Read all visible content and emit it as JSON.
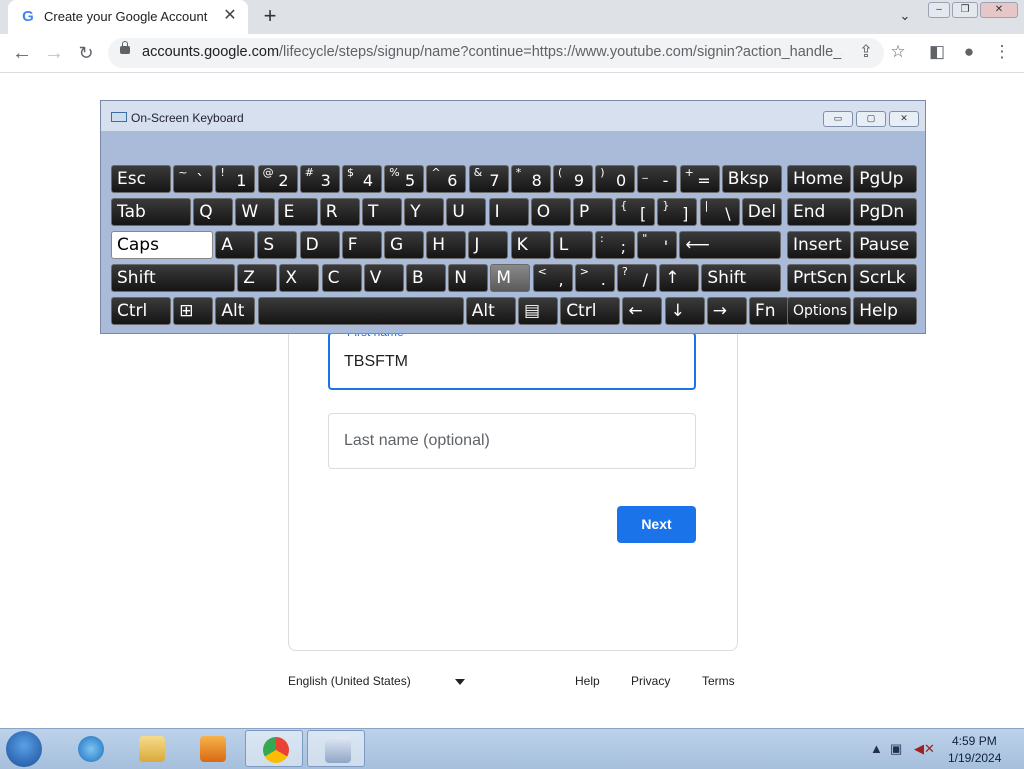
{
  "browser": {
    "tab_title": "Create your Google Account",
    "tab_favicon": "G",
    "url_host": "accounts.google.com",
    "url_rest": "/lifecycle/steps/signup/name?continue=https://www.youtube.com/signin?action_handle_si...",
    "colors": {
      "accent": "#1a73e8",
      "tabbar": "#dee1e6"
    }
  },
  "form": {
    "first_name_label": "First name",
    "first_name_value": "TBSFTM",
    "last_name_placeholder": "Last name (optional)",
    "next_label": "Next"
  },
  "footer": {
    "language": "English (United States)",
    "help": "Help",
    "privacy": "Privacy",
    "terms": "Terms"
  },
  "osk": {
    "title": "On-Screen Keyboard",
    "rows": [
      [
        {
          "l": "Esc"
        },
        {
          "s": "~",
          "m": "`"
        },
        {
          "s": "!",
          "m": "1"
        },
        {
          "s": "@",
          "m": "2"
        },
        {
          "s": "#",
          "m": "3"
        },
        {
          "s": "$",
          "m": "4"
        },
        {
          "s": "%",
          "m": "5"
        },
        {
          "s": "^",
          "m": "6"
        },
        {
          "s": "&",
          "m": "7"
        },
        {
          "s": "*",
          "m": "8"
        },
        {
          "s": "(",
          "m": "9"
        },
        {
          "s": ")",
          "m": "0"
        },
        {
          "s": "_",
          "m": "-"
        },
        {
          "s": "+",
          "m": "="
        },
        {
          "l": "Bksp"
        },
        {
          "l": "Home"
        },
        {
          "l": "PgUp"
        }
      ],
      [
        {
          "l": "Tab"
        },
        {
          "l": "Q"
        },
        {
          "l": "W"
        },
        {
          "l": "E"
        },
        {
          "l": "R"
        },
        {
          "l": "T"
        },
        {
          "l": "Y"
        },
        {
          "l": "U"
        },
        {
          "l": "I"
        },
        {
          "l": "O"
        },
        {
          "l": "P"
        },
        {
          "s": "{",
          "m": "["
        },
        {
          "s": "}",
          "m": "]"
        },
        {
          "s": "|",
          "m": "\\"
        },
        {
          "l": "Del"
        },
        {
          "l": "End"
        },
        {
          "l": "PgDn"
        }
      ],
      [
        {
          "l": "Caps",
          "active": true
        },
        {
          "l": "A"
        },
        {
          "l": "S"
        },
        {
          "l": "D"
        },
        {
          "l": "F"
        },
        {
          "l": "G"
        },
        {
          "l": "H"
        },
        {
          "l": "J"
        },
        {
          "l": "K"
        },
        {
          "l": "L"
        },
        {
          "s": ":",
          "m": ";"
        },
        {
          "s": "\"",
          "m": "'"
        },
        {
          "l": "⟵"
        },
        {
          "l": "Insert"
        },
        {
          "l": "Pause"
        }
      ],
      [
        {
          "l": "Shift"
        },
        {
          "l": "Z"
        },
        {
          "l": "X"
        },
        {
          "l": "C"
        },
        {
          "l": "V"
        },
        {
          "l": "B"
        },
        {
          "l": "N"
        },
        {
          "l": "M",
          "hover": true
        },
        {
          "s": "<",
          "m": ","
        },
        {
          "s": ">",
          "m": "."
        },
        {
          "s": "?",
          "m": "/"
        },
        {
          "l": "↑"
        },
        {
          "l": "Shift"
        },
        {
          "l": "PrtScn"
        },
        {
          "l": "ScrLk"
        }
      ],
      [
        {
          "l": "Ctrl"
        },
        {
          "l": "⊞"
        },
        {
          "l": "Alt"
        },
        {
          "l": ""
        },
        {
          "l": "Alt"
        },
        {
          "l": "▤"
        },
        {
          "l": "Ctrl"
        },
        {
          "l": "←"
        },
        {
          "l": "↓"
        },
        {
          "l": "→"
        },
        {
          "l": "Fn"
        },
        {
          "l": "Options"
        },
        {
          "l": "Help"
        }
      ]
    ]
  },
  "taskbar": {
    "time": "4:59 PM",
    "date": "1/19/2024",
    "apps": [
      "internet-explorer-icon",
      "file-explorer-icon",
      "media-player-icon",
      "chrome-icon",
      "on-screen-keyboard-icon"
    ]
  }
}
